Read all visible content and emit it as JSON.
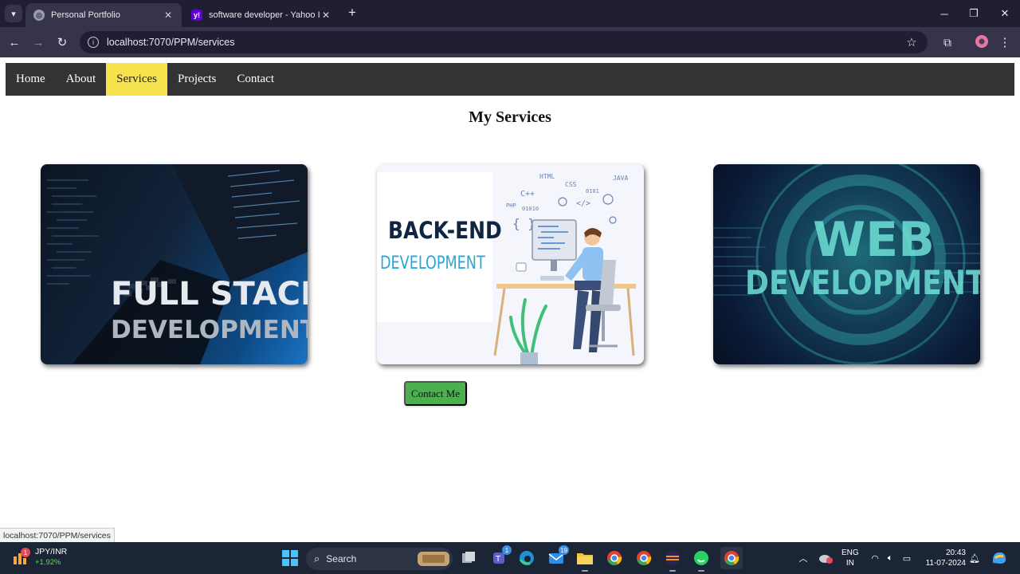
{
  "browser": {
    "tabs": [
      {
        "title": "Personal Portfolio",
        "active": true
      },
      {
        "title": "software developer - Yahoo Ind",
        "active": false
      }
    ],
    "new_tab": "+",
    "url": "localhost:7070/PPM/services",
    "status_url": "localhost:7070/PPM/services"
  },
  "site": {
    "nav": [
      "Home",
      "About",
      "Services",
      "Projects",
      "Contact"
    ],
    "active_nav": "Services",
    "title": "My Services",
    "cards": [
      {
        "line1": "FULL STACK",
        "line2": "DEVELOPMENT"
      },
      {
        "line1": "BACK-END",
        "line2": "DEVELOPMENT"
      },
      {
        "line1": "WEB",
        "line2": "DEVELOPMENT"
      }
    ],
    "contact_button": "Contact Me",
    "accent_color": "#f7e34d",
    "button_color": "#4caf50"
  },
  "taskbar": {
    "ticker_name": "JPY/INR",
    "ticker_change": "+1.92%",
    "ticker_badge": "1",
    "search_label": "Search",
    "teams_badge": "1",
    "mail_badge": "19",
    "lang_line1": "ENG",
    "lang_line2": "IN",
    "time": "20:43",
    "date": "11-07-2024"
  }
}
